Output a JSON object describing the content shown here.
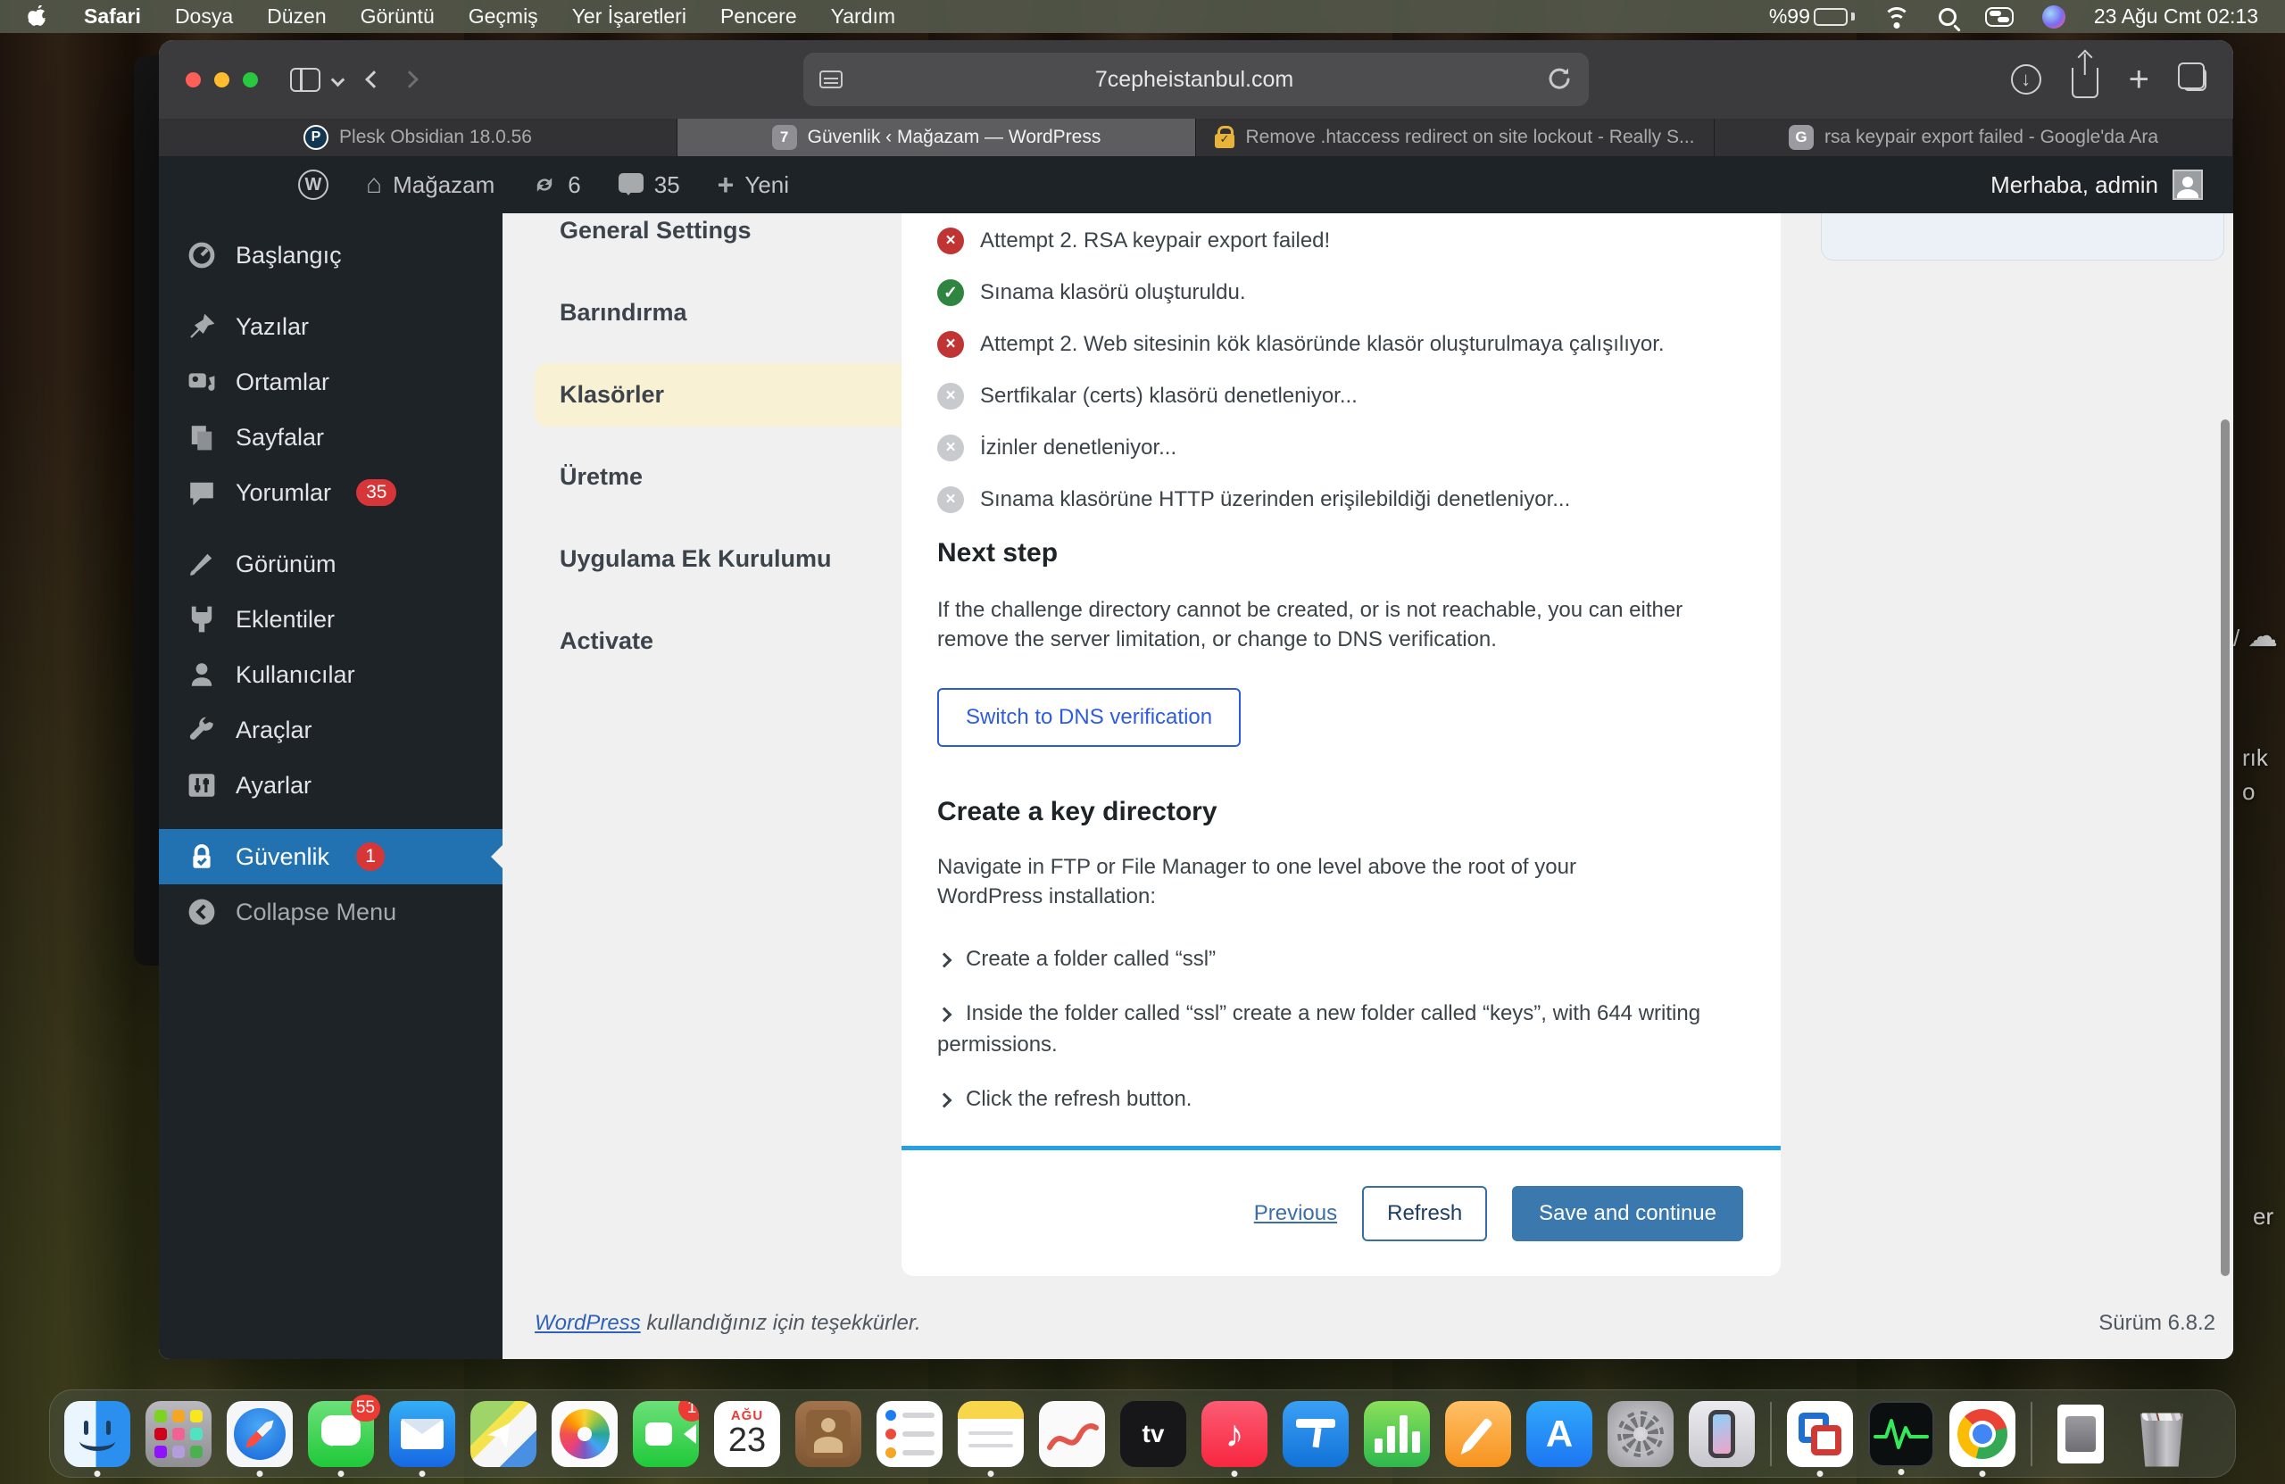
{
  "menu_bar": {
    "app_name": "Safari",
    "items": [
      "Dosya",
      "Düzen",
      "Görüntü",
      "Geçmiş",
      "Yer İşaretleri",
      "Pencere",
      "Yardım"
    ],
    "battery": "%99",
    "clock": "23 Ağu Cmt 02:13"
  },
  "browser": {
    "url": "7cepheistanbul.com",
    "tabs": [
      {
        "title": "Plesk Obsidian 18.0.56",
        "favicon": "P"
      },
      {
        "title": "Güvenlik ‹ Mağazam — WordPress",
        "favicon": "7"
      },
      {
        "title": "Remove .htaccess redirect on site lockout - Really S...",
        "favicon": "lock"
      },
      {
        "title": "rsa keypair export failed - Google'da Ara",
        "favicon": "G"
      }
    ]
  },
  "admin_bar": {
    "wp_logo": "W",
    "site_name": "Mağazam",
    "updates_count": "6",
    "comments_count": "35",
    "new_label": "Yeni",
    "greeting": "Merhaba, admin"
  },
  "sidebar": {
    "items": [
      {
        "label": "Başlangıç"
      },
      {
        "label": "Yazılar"
      },
      {
        "label": "Ortamlar"
      },
      {
        "label": "Sayfalar"
      },
      {
        "label": "Yorumlar",
        "badge": "35"
      },
      {
        "label": "Görünüm"
      },
      {
        "label": "Eklentiler"
      },
      {
        "label": "Kullanıcılar"
      },
      {
        "label": "Araçlar"
      },
      {
        "label": "Ayarlar"
      },
      {
        "label": "Güvenlik",
        "badge": "1"
      },
      {
        "label": "Collapse Menu"
      }
    ]
  },
  "wizard_menu": {
    "items": [
      "General Settings",
      "Barındırma",
      "Klasörler",
      "Üretme",
      "Uygulama Ek Kurulumu",
      "Activate"
    ],
    "active": "Klasörler"
  },
  "status_list": [
    {
      "state": "error",
      "text": "Attempt 2.  RSA keypair export failed!"
    },
    {
      "state": "success",
      "text": "Sınama klasörü oluşturuldu."
    },
    {
      "state": "error",
      "text": "Attempt 2.  Web sitesinin kök klasöründe klasör oluşturulmaya çalışılıyor."
    },
    {
      "state": "pending",
      "text": "Sertfikalar (certs) klasörü denetleniyor..."
    },
    {
      "state": "pending",
      "text": "İzinler denetleniyor..."
    },
    {
      "state": "pending",
      "text": "Sınama klasörüne HTTP üzerinden erişilebildiği denetleniyor..."
    }
  ],
  "next_step": {
    "heading": "Next step",
    "body": "If the challenge directory cannot be created, or is not reachable, you can either remove the server limitation, or change to DNS verification.",
    "switch_button": "Switch to DNS verification"
  },
  "key_directory": {
    "heading": "Create a key directory",
    "body": "Navigate in FTP or File Manager to one level above the root of your WordPress installation:",
    "bullets": [
      "Create a folder called “ssl”",
      "Inside the folder called “ssl” create a new folder called “keys”, with 644 writing permissions.",
      "Click the refresh button."
    ]
  },
  "wizard_footer": {
    "previous": "Previous",
    "refresh": "Refresh",
    "save": "Save and continue"
  },
  "page_footer": {
    "thanks_link": "WordPress",
    "thanks_rest": " kullandığınız için teşekkürler.",
    "version": "Sürüm 6.8.2"
  },
  "desktop": {
    "fragments": [
      "/",
      "rık",
      "o",
      "er"
    ]
  },
  "dock": {
    "messages_badge": "55",
    "facetime_badge": "1",
    "calendar_month": "AĞU",
    "calendar_day": "23",
    "tv_label": "tv",
    "music_glyph": "♪",
    "appstore_glyph": "A"
  },
  "colors": {
    "selected_menu": "#2271b1",
    "badge_red": "#d63638",
    "error_icon": "#c03434",
    "success_icon": "#2e8540",
    "pending_icon": "#c9cace",
    "dns_button_blue": "#2e5ce0",
    "footer_divider_blue": "#25a0e3",
    "save_button_blue": "#3a78ad",
    "submenu_highlight": "#f9f1d3"
  }
}
